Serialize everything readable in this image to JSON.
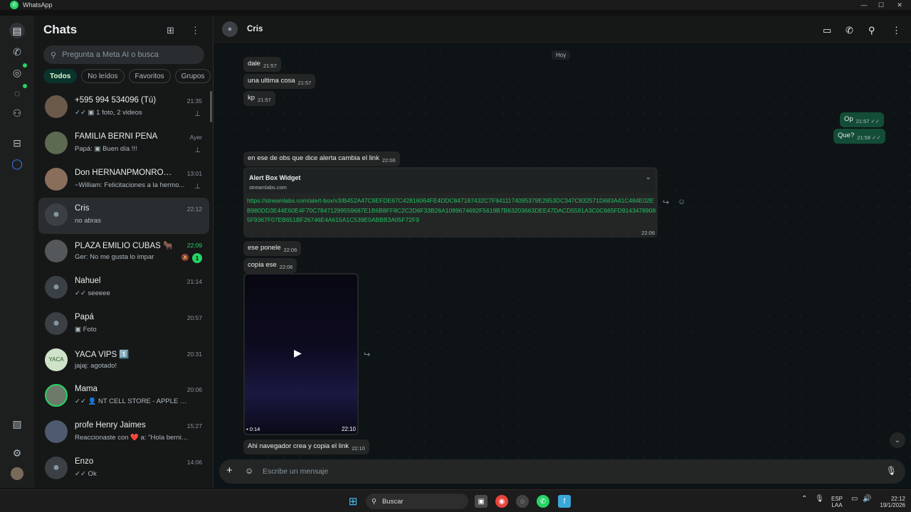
{
  "window": {
    "title": "WhatsApp",
    "minimize": "—",
    "maximize": "☐",
    "close": "✕"
  },
  "sidebar": {
    "title": "Chats",
    "search_placeholder": "Pregunta a Meta AI o busca",
    "filters": [
      "Todos",
      "No leídos",
      "Favoritos",
      "Grupos"
    ],
    "chats": [
      {
        "name": "+595 994 534096 (Tú)",
        "preview": "✓✓ ▣ 1 foto, 2 videos",
        "time": "21:35",
        "pinned": true
      },
      {
        "name": "FAMILIA BERNI PEÑA",
        "preview": "Papá: ▣ Buen día !!!",
        "time": "Ayer",
        "pinned": true
      },
      {
        "name": "Don HERNANPMONROY y flia",
        "preview": "~William: Felicitaciones a la hermo...",
        "time": "13:01",
        "pinned": true
      },
      {
        "name": "Cris",
        "preview": "no abras",
        "time": "22:12",
        "selected": true
      },
      {
        "name": "PLAZA EMILIO CUBAS 🐂",
        "preview": "Ger: No me gusta lo impar",
        "time": "22:09",
        "unread": "1"
      },
      {
        "name": "Nahuel",
        "preview": "✓✓ seeeee",
        "time": "21:14"
      },
      {
        "name": "Papá",
        "preview": "▣ Foto",
        "time": "20:57"
      },
      {
        "name": "YACA VIPS 1️⃣",
        "preview": "jajaj: agotado!",
        "time": "20:31"
      },
      {
        "name": "Mama",
        "preview": "✓✓ 👤 NT CELL STORE - APPLE IPHON...",
        "time": "20:06"
      },
      {
        "name": "profe Henry Jaimes",
        "preview": "Reaccionaste con ❤️ a: \"Hola berni lis...",
        "time": "15:27"
      },
      {
        "name": "Enzo",
        "preview": "✓✓ Ok",
        "time": "14:06"
      }
    ]
  },
  "conversation": {
    "contact": "Cris",
    "date_label": "Hoy",
    "messages": {
      "m1": {
        "text": "dale",
        "time": "21:57"
      },
      "m2": {
        "text": "una ultima cosa",
        "time": "21:57"
      },
      "m3": {
        "text": "kp",
        "time": "21:57"
      },
      "o1": {
        "text": "Op",
        "time": "21:57 ✓✓"
      },
      "o2": {
        "text": "Que?",
        "time": "21:58 ✓✓"
      },
      "m4": {
        "text": "en ese de obs que dice alerta cambia el link",
        "time": "22:06"
      },
      "link": {
        "card_title": "Alert Box Widget",
        "card_site": "streamlabs.com",
        "url": "https://streamlabs.com/alert-box/v3/B452A47C8EFDE67C42816064FE4DDC847187432C7F9411174095379E2853DC347C832571D683A41C484E02EB980DD3E44E60E4F70C78471299559687E1B6B8FF8C2C2D6F33B26A1089674692F5619B7B63203663DEE47DACD5591A3C0C665FD91434789085F9367F07EB651BF26746E4A615A1C539E0ABBB3A05F72F9",
        "time": "22:06"
      },
      "m5": {
        "text": "ese ponele",
        "time": "22:06"
      },
      "m6": {
        "text": "copia ese",
        "time": "22:06"
      },
      "video": {
        "duration": "0:14",
        "time": "22:10"
      },
      "m7": {
        "text": "Ahi navegador crea y copia el link",
        "time": "22:10"
      }
    },
    "compose_placeholder": "Escribe un mensaje"
  },
  "taskbar": {
    "search_label": "Buscar",
    "lang_top": "ESP",
    "lang_bottom": "LAA",
    "clock_time": "22:12",
    "clock_date": "19/1/2026"
  }
}
